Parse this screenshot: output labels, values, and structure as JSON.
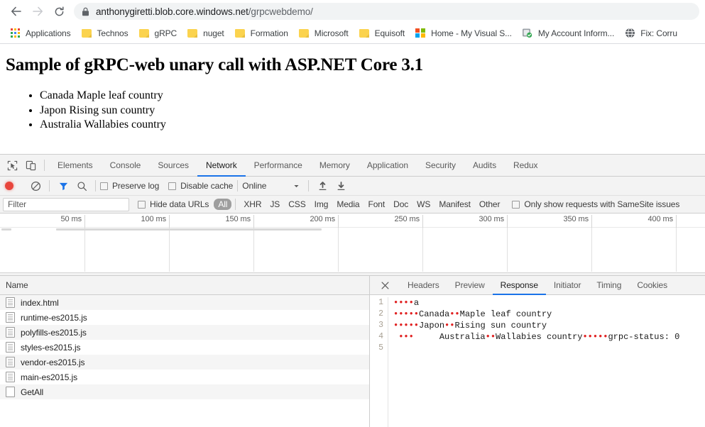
{
  "browser": {
    "nav": {
      "back_icon": "arrow-left-icon",
      "forward_icon": "arrow-right-icon",
      "reload_icon": "reload-icon"
    },
    "omnibox": {
      "lock_icon": "lock-icon",
      "url_host": "anthonygiretti.blob.core.windows.net",
      "url_path": "/grpcwebdemo/"
    },
    "bookmarks": [
      {
        "label": "Applications",
        "icon": "apps-grid-icon"
      },
      {
        "label": "Technos",
        "icon": "folder-icon"
      },
      {
        "label": "gRPC",
        "icon": "folder-icon"
      },
      {
        "label": "nuget",
        "icon": "folder-icon"
      },
      {
        "label": "Formation",
        "icon": "folder-icon"
      },
      {
        "label": "Microsoft",
        "icon": "folder-icon"
      },
      {
        "label": "Equisoft",
        "icon": "folder-icon"
      },
      {
        "label": "Home - My Visual S...",
        "icon": "microsoft-icon"
      },
      {
        "label": "My Account Inform...",
        "icon": "account-shield-icon"
      },
      {
        "label": "Fix: Corru",
        "icon": "globe-icon"
      }
    ]
  },
  "page": {
    "title": "Sample of gRPC-web unary call with ASP.NET Core 3.1",
    "countries": [
      "Canada Maple leaf country",
      "Japon Rising sun country",
      "Australia Wallabies country"
    ]
  },
  "devtools": {
    "inspect_icon": "inspect-element-icon",
    "device_icon": "device-toolbar-icon",
    "tabs": [
      {
        "label": "Elements",
        "active": false
      },
      {
        "label": "Console",
        "active": false
      },
      {
        "label": "Sources",
        "active": false
      },
      {
        "label": "Network",
        "active": true
      },
      {
        "label": "Performance",
        "active": false
      },
      {
        "label": "Memory",
        "active": false
      },
      {
        "label": "Application",
        "active": false
      },
      {
        "label": "Security",
        "active": false
      },
      {
        "label": "Audits",
        "active": false
      },
      {
        "label": "Redux",
        "active": false
      }
    ],
    "toolbar": {
      "record_icon": "record-button",
      "clear_icon": "clear-icon",
      "filter_icon": "filter-funnel-icon",
      "search_icon": "search-icon",
      "preserve_log_label": "Preserve log",
      "preserve_log_checked": false,
      "disable_cache_label": "Disable cache",
      "disable_cache_checked": false,
      "throttle_value": "Online",
      "throttle_caret_icon": "chevron-down-icon",
      "import_icon": "import-har-icon",
      "export_icon": "export-har-icon"
    },
    "filter": {
      "placeholder": "Filter",
      "value": "",
      "hide_data_urls_label": "Hide data URLs",
      "hide_data_urls_checked": false,
      "types": [
        "All",
        "XHR",
        "JS",
        "CSS",
        "Img",
        "Media",
        "Font",
        "Doc",
        "WS",
        "Manifest",
        "Other"
      ],
      "selected_type": "All",
      "samesite_label": "Only show requests with SameSite issues",
      "samesite_checked": false
    },
    "timeline": {
      "ticks": [
        "50 ms",
        "100 ms",
        "150 ms",
        "200 ms",
        "250 ms",
        "300 ms",
        "350 ms",
        "400 ms"
      ]
    },
    "requests": {
      "column_header": "Name",
      "rows": [
        {
          "name": "index.html",
          "icon": "document-icon"
        },
        {
          "name": "runtime-es2015.js",
          "icon": "document-icon"
        },
        {
          "name": "polyfills-es2015.js",
          "icon": "document-icon"
        },
        {
          "name": "styles-es2015.js",
          "icon": "document-icon"
        },
        {
          "name": "vendor-es2015.js",
          "icon": "document-icon"
        },
        {
          "name": "main-es2015.js",
          "icon": "document-icon"
        },
        {
          "name": "GetAll",
          "icon": "blank-document-icon"
        }
      ]
    },
    "detail": {
      "close_icon": "close-icon",
      "tabs": [
        {
          "label": "Headers",
          "active": false
        },
        {
          "label": "Preview",
          "active": false
        },
        {
          "label": "Response",
          "active": true
        },
        {
          "label": "Initiator",
          "active": false
        },
        {
          "label": "Timing",
          "active": false
        },
        {
          "label": "Cookies",
          "active": false
        }
      ],
      "response_lines": [
        {
          "num": "1",
          "parts": [
            {
              "t": "ctrl",
              "v": "••••"
            },
            {
              "t": "text",
              "v": "a"
            }
          ]
        },
        {
          "num": "2",
          "parts": [
            {
              "t": "ctrl",
              "v": "•••••"
            },
            {
              "t": "text",
              "v": "Canada"
            },
            {
              "t": "ctrl",
              "v": "••"
            },
            {
              "t": "text",
              "v": "Maple leaf country"
            }
          ]
        },
        {
          "num": "3",
          "parts": [
            {
              "t": "ctrl",
              "v": "•••••"
            },
            {
              "t": "text",
              "v": "Japon"
            },
            {
              "t": "ctrl",
              "v": "••"
            },
            {
              "t": "text",
              "v": "Rising sun country"
            }
          ]
        },
        {
          "num": "4",
          "parts": [
            {
              "t": "text",
              "v": " "
            },
            {
              "t": "ctrl",
              "v": "•••"
            },
            {
              "t": "text",
              "v": "     Australia"
            },
            {
              "t": "ctrl",
              "v": "••"
            },
            {
              "t": "text",
              "v": "Wallabies country"
            },
            {
              "t": "ctrl",
              "v": "•••••"
            },
            {
              "t": "text",
              "v": "grpc-status: 0"
            }
          ]
        },
        {
          "num": "5",
          "parts": []
        }
      ]
    }
  },
  "colors": {
    "accent_blue": "#1a73e8",
    "record_red": "#e8453c",
    "control_char_red": "#e02020",
    "folder_yellow": "#fbd34e",
    "selected_filter_gray": "#9e9e9e"
  }
}
